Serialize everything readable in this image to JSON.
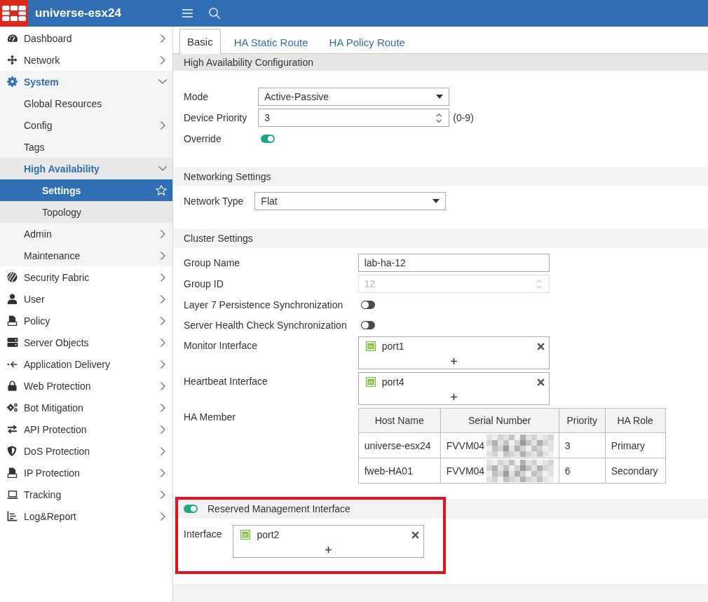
{
  "header": {
    "title": "universe-esx24"
  },
  "sidebar": {
    "items": [
      {
        "label": "Dashboard",
        "has_submenu": true,
        "expanded": false,
        "selected": false
      },
      {
        "label": "Network",
        "has_submenu": true,
        "expanded": false,
        "selected": false
      },
      {
        "label": "System",
        "has_submenu": true,
        "expanded": true,
        "selected": false,
        "children": [
          {
            "label": "Global Resources",
            "has_submenu": false,
            "expanded": false,
            "selected": false
          },
          {
            "label": "Config",
            "has_submenu": true,
            "expanded": false,
            "selected": false
          },
          {
            "label": "Tags",
            "has_submenu": false,
            "expanded": false,
            "selected": false
          },
          {
            "label": "High Availability",
            "has_submenu": true,
            "expanded": true,
            "selected": false,
            "children": [
              {
                "label": "Settings",
                "has_submenu": false,
                "expanded": false,
                "selected": true
              },
              {
                "label": "Topology",
                "has_submenu": false,
                "expanded": false,
                "selected": false
              }
            ]
          },
          {
            "label": "Admin",
            "has_submenu": true,
            "expanded": false,
            "selected": false
          },
          {
            "label": "Maintenance",
            "has_submenu": true,
            "expanded": false,
            "selected": false
          }
        ]
      },
      {
        "label": "Security Fabric",
        "has_submenu": true,
        "expanded": false,
        "selected": false
      },
      {
        "label": "User",
        "has_submenu": true,
        "expanded": false,
        "selected": false
      },
      {
        "label": "Policy",
        "has_submenu": true,
        "expanded": false,
        "selected": false
      },
      {
        "label": "Server Objects",
        "has_submenu": true,
        "expanded": false,
        "selected": false
      },
      {
        "label": "Application Delivery",
        "has_submenu": true,
        "expanded": false,
        "selected": false
      },
      {
        "label": "Web Protection",
        "has_submenu": true,
        "expanded": false,
        "selected": false
      },
      {
        "label": "Bot Mitigation",
        "has_submenu": true,
        "expanded": false,
        "selected": false
      },
      {
        "label": "API Protection",
        "has_submenu": true,
        "expanded": false,
        "selected": false
      },
      {
        "label": "DoS Protection",
        "has_submenu": true,
        "expanded": false,
        "selected": false
      },
      {
        "label": "IP Protection",
        "has_submenu": true,
        "expanded": false,
        "selected": false
      },
      {
        "label": "Tracking",
        "has_submenu": true,
        "expanded": false,
        "selected": false
      },
      {
        "label": "Log&Report",
        "has_submenu": true,
        "expanded": false,
        "selected": false
      }
    ]
  },
  "tabs": [
    {
      "label": "Basic",
      "selected": true
    },
    {
      "label": "HA Static Route",
      "selected": false
    },
    {
      "label": "HA Policy Route",
      "selected": false
    }
  ],
  "sections": [
    {
      "title": "High Availability Configuration",
      "highlighted": false,
      "fields": [
        {
          "kind": "select",
          "label": "Mode",
          "value": "Active-Passive"
        },
        {
          "kind": "number",
          "label": "Device Priority",
          "value": "3",
          "disabled": false,
          "range_note": "(0-9)"
        },
        {
          "kind": "toggle",
          "label": "Override",
          "on": true
        }
      ]
    },
    {
      "title": "Networking Settings",
      "highlighted": false,
      "fields": [
        {
          "kind": "select",
          "label": "Network Type",
          "value": "Flat"
        }
      ]
    },
    {
      "title": "Cluster Settings",
      "highlighted": false,
      "fields": [
        {
          "kind": "text",
          "label": "Group Name",
          "value": "lab-ha-12"
        },
        {
          "kind": "number",
          "label": "Group ID",
          "value": "12",
          "disabled": true
        },
        {
          "kind": "toggle",
          "label": "Layer 7 Persistence Synchronization",
          "on": false
        },
        {
          "kind": "toggle",
          "label": "Server Health Check Synchronization",
          "on": false
        },
        {
          "kind": "interfaces",
          "label": "Monitor Interface",
          "items": [
            "port1"
          ]
        },
        {
          "kind": "interfaces",
          "label": "Heartbeat Interface",
          "items": [
            "port4"
          ]
        },
        {
          "kind": "table",
          "label": "HA Member",
          "columns": [
            "Host Name",
            "Serial Number",
            "Priority",
            "HA Role"
          ],
          "rows": [
            {
              "cells": [
                "universe-esx24",
                "FVVM04",
                "3",
                "Primary"
              ],
              "redacted": true
            },
            {
              "cells": [
                "fweb-HA01",
                "FVVM04",
                "6",
                "Secondary"
              ],
              "redacted": true
            }
          ]
        }
      ]
    },
    {
      "title": "Reserved Management Interface",
      "enabled": true,
      "highlighted": true,
      "fields": [
        {
          "kind": "interfaces",
          "label": "Interface",
          "items": [
            "port2"
          ]
        }
      ]
    }
  ]
}
